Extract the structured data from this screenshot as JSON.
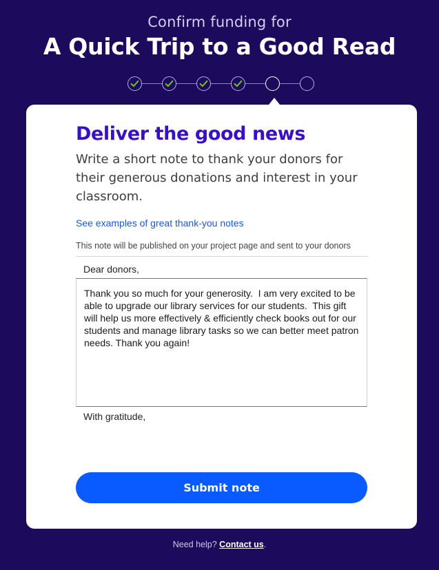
{
  "header": {
    "subtitle": "Confirm funding for",
    "title": "A Quick Trip to a Good Read"
  },
  "progress": {
    "steps": [
      {
        "state": "complete",
        "icon": "check-icon"
      },
      {
        "state": "complete",
        "icon": "check-icon"
      },
      {
        "state": "complete",
        "icon": "check-icon"
      },
      {
        "state": "complete",
        "icon": "check-icon"
      },
      {
        "state": "current"
      },
      {
        "state": "upcoming"
      }
    ],
    "current_step": 5,
    "total_steps": 6,
    "check_color": "#6fbf1f"
  },
  "card": {
    "title": "Deliver the good news",
    "description": "Write a short note to thank your donors for their generous donations and interest in your classroom.",
    "examples_link": "See examples of great thank-you notes",
    "publish_note": "This note will be published on your project page and sent to your donors",
    "salutation": "Dear donors,",
    "body": "Thank you so much for your generosity.  I am very excited to be able to upgrade our library services for our students.  This gift will help us more effectively & efficiently check books out for our students and manage library tasks so we can better meet patron needs. Thank you again!",
    "closing": "With gratitude,",
    "submit_label": "Submit note"
  },
  "footer": {
    "help_text": "Need help? ",
    "contact_link": "Contact us",
    "period": "."
  },
  "colors": {
    "background": "#1c0a5c",
    "title_accent": "#3a10c7",
    "button": "#0a5bff",
    "link": "#1a56db"
  }
}
